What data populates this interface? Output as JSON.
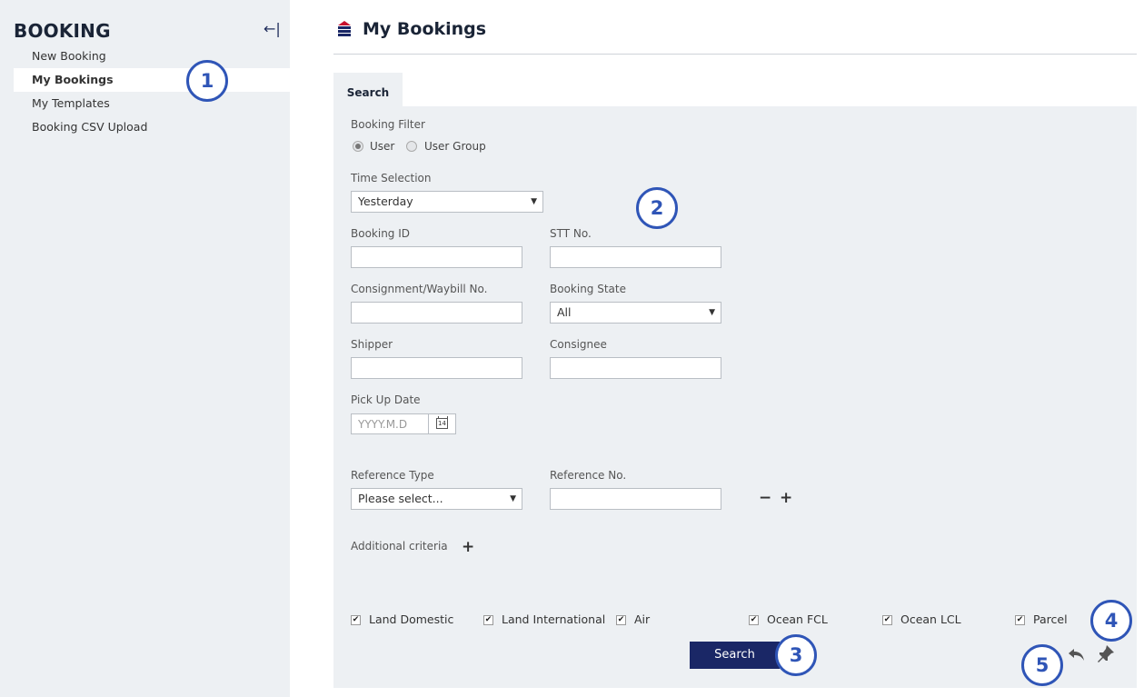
{
  "sidebar": {
    "title": "BOOKING",
    "collapse_icon": "←|",
    "items": [
      {
        "label": "New Booking"
      },
      {
        "label": "My Bookings"
      },
      {
        "label": "My Templates"
      },
      {
        "label": "Booking CSV Upload"
      }
    ]
  },
  "page": {
    "title": "My Bookings",
    "tab": "Search"
  },
  "form": {
    "booking_filter_label": "Booking Filter",
    "radio_user": "User",
    "radio_user_group": "User Group",
    "time_selection_label": "Time Selection",
    "time_selection_value": "Yesterday",
    "booking_id_label": "Booking ID",
    "booking_id_value": "",
    "stt_label": "STT No.",
    "stt_value": "",
    "consignment_label": "Consignment/Waybill No.",
    "consignment_value": "",
    "booking_state_label": "Booking State",
    "booking_state_value": "All",
    "shipper_label": "Shipper",
    "shipper_value": "",
    "consignee_label": "Consignee",
    "consignee_value": "",
    "pickup_label": "Pick Up Date",
    "pickup_placeholder": "YYYY.M.D",
    "calendar_day": "14",
    "reference_type_label": "Reference Type",
    "reference_type_value": "Please select...",
    "reference_no_label": "Reference No.",
    "reference_no_value": "",
    "minus_symbol": "−",
    "plus_symbol": "+",
    "additional_label": "Additional criteria",
    "checkboxes": [
      {
        "label": "Land Domestic",
        "checked": true
      },
      {
        "label": "Land International",
        "checked": true
      },
      {
        "label": "Air",
        "checked": true
      },
      {
        "label": "Ocean FCL",
        "checked": true
      },
      {
        "label": "Ocean LCL",
        "checked": true
      },
      {
        "label": "Parcel",
        "checked": true
      }
    ],
    "check_mark": "✔",
    "search_button": "Search"
  },
  "callouts": [
    "1",
    "2",
    "3",
    "4",
    "5"
  ],
  "colors": {
    "accent": "#1a2766",
    "callout": "#2f55b7",
    "panel_bg": "#edf0f3"
  }
}
